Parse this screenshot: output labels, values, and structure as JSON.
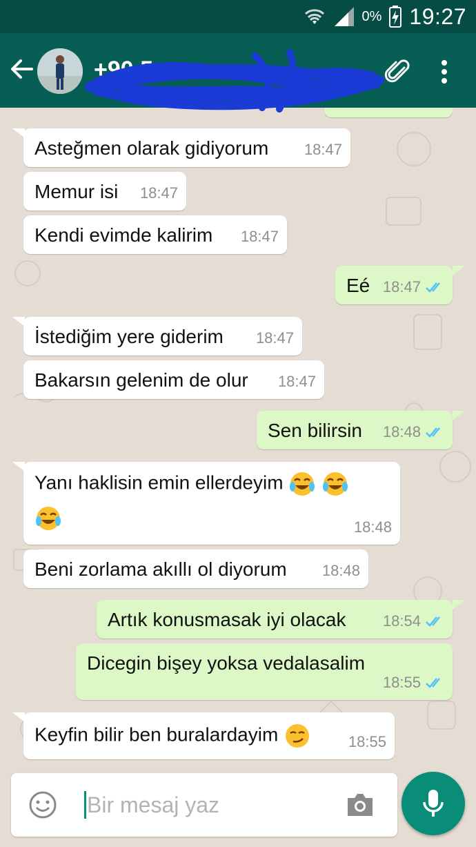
{
  "status_bar": {
    "battery_percent": "0%",
    "time": "19:27"
  },
  "header": {
    "contact_name": "+90 5",
    "back_icon": "arrow-back-icon",
    "attach_icon": "paperclip-icon",
    "menu_icon": "more-vert-icon"
  },
  "messages": [
    {
      "dir": "in",
      "text": "Asteğmen olarak gidiyorum",
      "time": "18:47"
    },
    {
      "dir": "in",
      "text": "Memur isi",
      "time": "18:47"
    },
    {
      "dir": "in",
      "text": "Kendi evimde kalirim",
      "time": "18:47"
    },
    {
      "dir": "out",
      "text": "Eé",
      "time": "18:47"
    },
    {
      "dir": "in",
      "text": "İstediğim yere giderim",
      "time": "18:47"
    },
    {
      "dir": "in",
      "text": "Bakarsın gelenim de olur",
      "time": "18:47"
    },
    {
      "dir": "out",
      "text": "Sen bilirsin",
      "time": "18:48"
    },
    {
      "dir": "in",
      "text": "Yanı haklisin emin ellerdeyim",
      "time": "18:48"
    },
    {
      "dir": "in",
      "text": "Beni zorlama akıllı ol diyorum",
      "time": "18:48"
    },
    {
      "dir": "out",
      "text": "Artık konusmasak iyi olacak",
      "time": "18:54"
    },
    {
      "dir": "out",
      "text": "Dicegin bişey yoksa vedalasalim",
      "time": "18:55"
    },
    {
      "dir": "in",
      "text": "Keyfin bilir ben buralardayim",
      "time": "18:55"
    }
  ],
  "composer": {
    "placeholder": "Bir mesaj yaz",
    "emoji_icon": "smiley-icon",
    "camera_icon": "camera-icon",
    "mic_icon": "microphone-icon"
  },
  "colors": {
    "status_bar": "#054c44",
    "app_bar": "#075e54",
    "incoming_bubble": "#ffffff",
    "outgoing_bubble": "#dcf8c6",
    "read_ticks": "#4fc3f7",
    "mic_button": "#0a8d78"
  }
}
